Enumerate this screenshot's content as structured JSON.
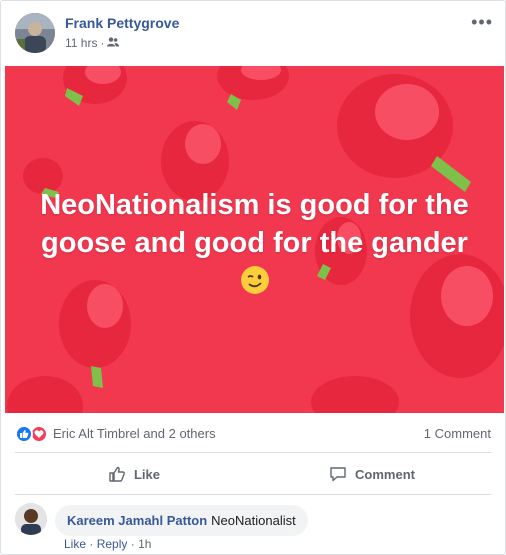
{
  "post": {
    "author": "Frank Pettygrove",
    "time": "11 hrs",
    "separator": "·",
    "more_glyph": "•••",
    "audience_icon": "friends-icon",
    "banner_text": "NeoNationalism is good for the goose and good for the gander",
    "banner_emoji": "winking-face-emoji"
  },
  "reactions": {
    "names": "Eric Alt Timbrel and 2 others",
    "comment_count": "1 Comment",
    "icons": [
      "like-reaction-icon",
      "love-reaction-icon"
    ]
  },
  "actions": {
    "like": "Like",
    "comment": "Comment"
  },
  "comments": [
    {
      "author": "Kareem Jamahl Patton",
      "text": "NeoNationalist",
      "like": "Like",
      "reply": "Reply",
      "sep": "·",
      "time": "1h"
    }
  ],
  "colors": {
    "banner": "#f1384f",
    "link": "#385898",
    "like": "#1877f2",
    "love": "#f33e58"
  }
}
